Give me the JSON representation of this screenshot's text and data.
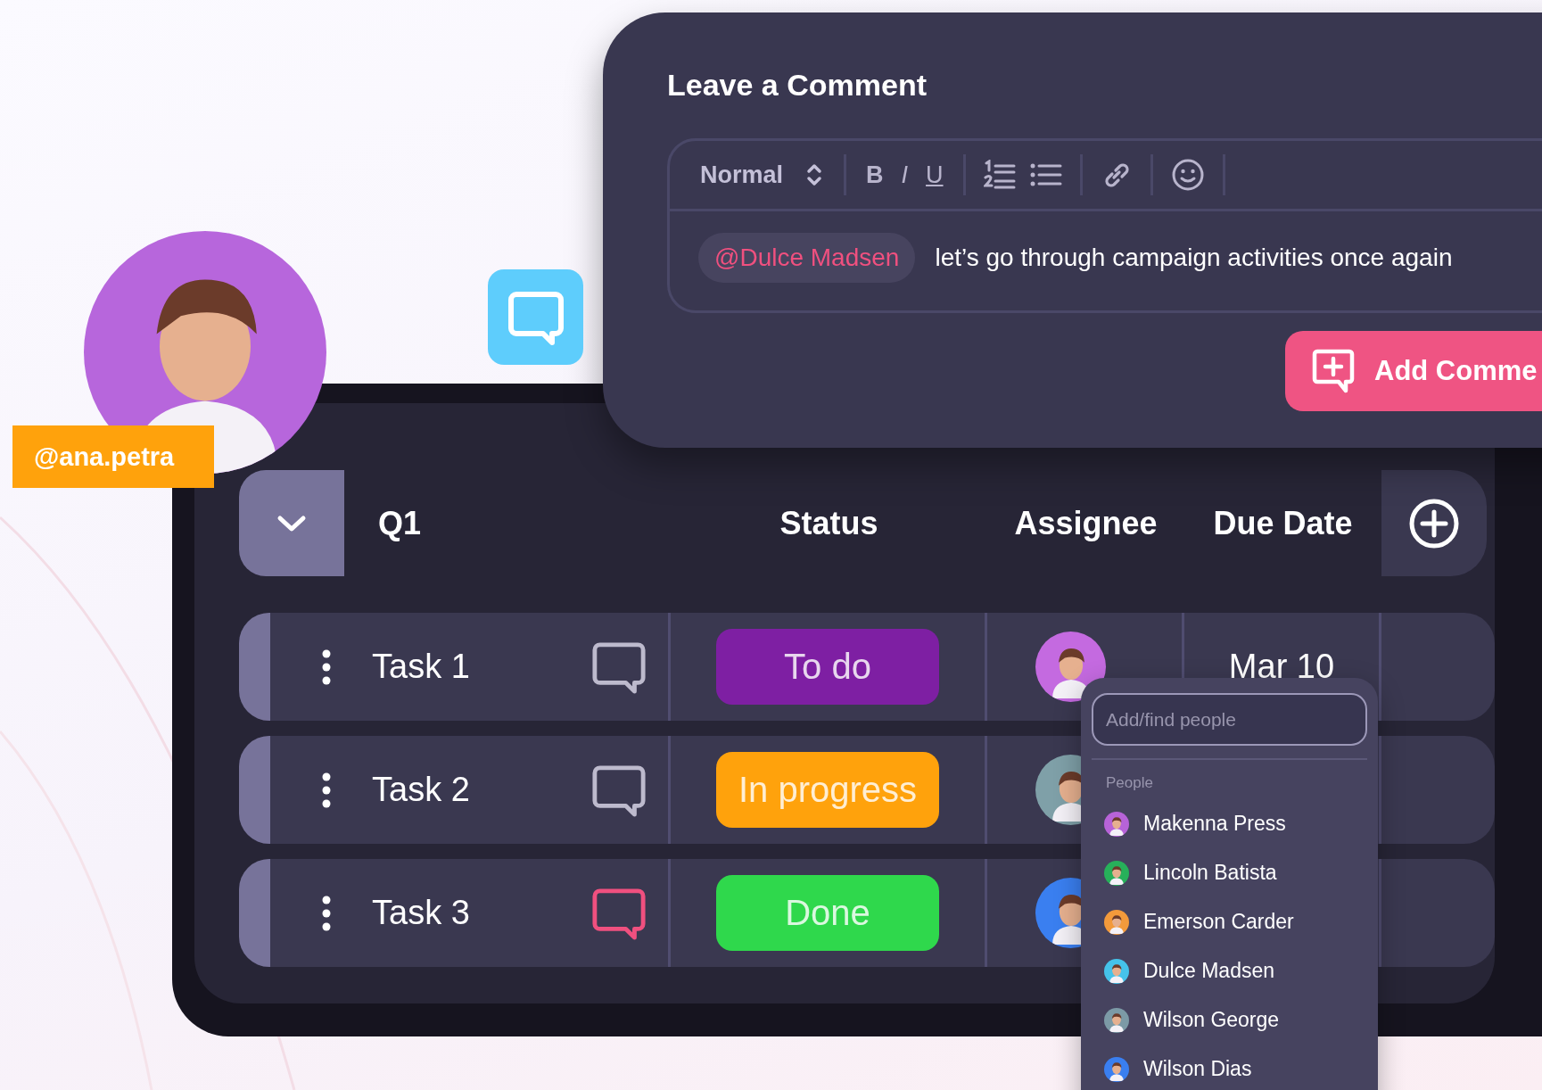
{
  "comment_panel": {
    "title": "Leave a Comment",
    "format": "Normal",
    "format_buttons": [
      {
        "label": "B",
        "kind": "bold"
      },
      {
        "label": "I",
        "kind": "italic"
      },
      {
        "label": "U",
        "kind": "underline"
      }
    ],
    "mention": "@Dulce Madsen",
    "text": "let’s go through campaign activities once again",
    "submit": "Add Comme"
  },
  "user_tag": "@ana.petra",
  "board": {
    "group": "Q1",
    "expanded": true,
    "columns": [
      "Status",
      "Assignee",
      "Due Date"
    ],
    "rows": [
      {
        "task": "Task 1",
        "unread_comment": false,
        "status": {
          "label": "To do",
          "color": "#7e1fa3"
        },
        "assignee": {
          "color": "#c46ae0"
        },
        "due": "Mar 10"
      },
      {
        "task": "Task 2",
        "unread_comment": false,
        "status": {
          "label": "In progress",
          "color": "#ffa20c"
        },
        "assignee": {
          "color": "#7fa0a8"
        }
      },
      {
        "task": "Task 3",
        "unread_comment": true,
        "status": {
          "label": "Done",
          "color": "#2fd84c"
        },
        "assignee": {
          "color": "#3a7ff0"
        }
      }
    ]
  },
  "people_picker": {
    "placeholder": "Add/find people",
    "section": "People",
    "people": [
      {
        "name": "Makenna Press",
        "color": "#b763d8"
      },
      {
        "name": "Lincoln Batista",
        "color": "#27b05a"
      },
      {
        "name": "Emerson Carder",
        "color": "#f39a3b"
      },
      {
        "name": "Dulce Madsen",
        "color": "#45c3ea"
      },
      {
        "name": "Wilson George",
        "color": "#7c9aa6"
      },
      {
        "name": "Wilson Dias",
        "color": "#3a7ff0"
      }
    ]
  }
}
